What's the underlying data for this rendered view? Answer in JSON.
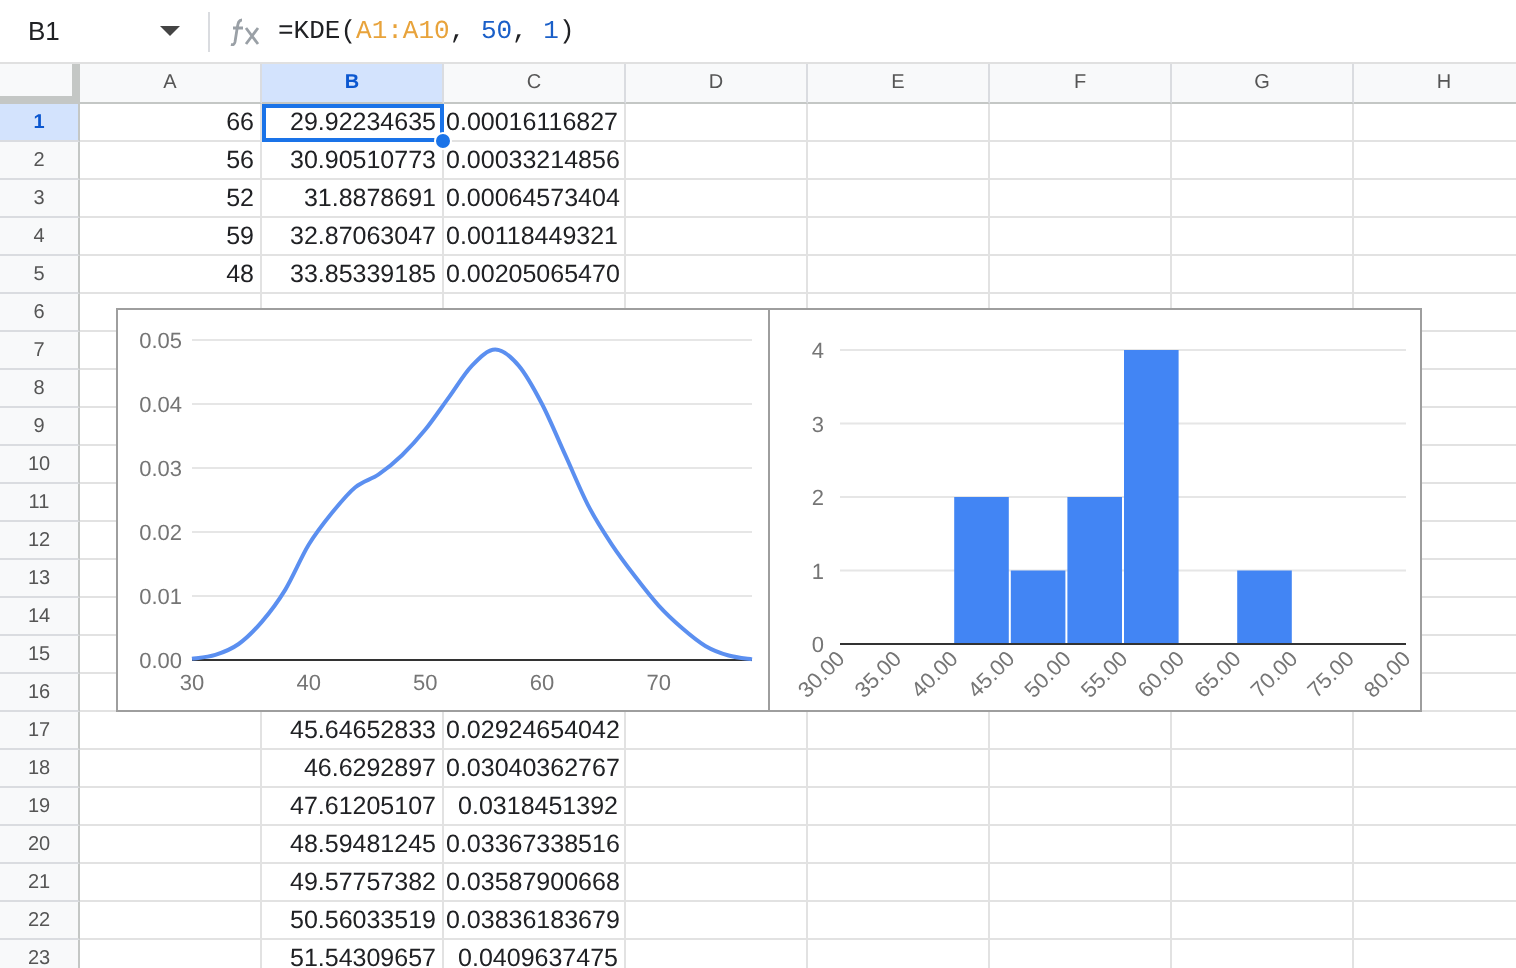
{
  "name_box": {
    "value": "B1"
  },
  "formula": [
    {
      "kind": "text",
      "text": "=KDE("
    },
    {
      "kind": "range",
      "text": "A1:A10"
    },
    {
      "kind": "text",
      "text": ", "
    },
    {
      "kind": "number",
      "text": "50"
    },
    {
      "kind": "text",
      "text": ", "
    },
    {
      "kind": "number",
      "text": "1"
    },
    {
      "kind": "text",
      "text": ")"
    }
  ],
  "columns": [
    {
      "label": "A",
      "selected": false
    },
    {
      "label": "B",
      "selected": true
    },
    {
      "label": "C",
      "selected": false
    },
    {
      "label": "D",
      "selected": false
    },
    {
      "label": "E",
      "selected": false
    },
    {
      "label": "F",
      "selected": false
    },
    {
      "label": "G",
      "selected": false
    },
    {
      "label": "H",
      "selected": false
    }
  ],
  "rows": [
    {
      "label": "1",
      "selected": true,
      "cells": {
        "col_a": "66",
        "col_b": "29.92234635",
        "col_c": "0.00016116827"
      }
    },
    {
      "label": "2",
      "selected": false,
      "cells": {
        "col_a": "56",
        "col_b": "30.90510773",
        "col_c": "0.00033214856"
      }
    },
    {
      "label": "3",
      "selected": false,
      "cells": {
        "col_a": "52",
        "col_b": "31.8878691",
        "col_c": "0.00064573404"
      }
    },
    {
      "label": "4",
      "selected": false,
      "cells": {
        "col_a": "59",
        "col_b": "32.87063047",
        "col_c": "0.00118449321"
      }
    },
    {
      "label": "5",
      "selected": false,
      "cells": {
        "col_a": "48",
        "col_b": "33.85339185",
        "col_c": "0.00205065470"
      }
    },
    {
      "label": "6",
      "selected": false
    },
    {
      "label": "7",
      "selected": false
    },
    {
      "label": "8",
      "selected": false
    },
    {
      "label": "9",
      "selected": false
    },
    {
      "label": "10",
      "selected": false
    },
    {
      "label": "11",
      "selected": false
    },
    {
      "label": "12",
      "selected": false
    },
    {
      "label": "13",
      "selected": false
    },
    {
      "label": "14",
      "selected": false
    },
    {
      "label": "15",
      "selected": false
    },
    {
      "label": "16",
      "selected": false
    },
    {
      "label": "17",
      "selected": false,
      "cells": {
        "col_b": "45.64652833",
        "col_c": "0.02924654042"
      }
    },
    {
      "label": "18",
      "selected": false,
      "cells": {
        "col_b": "46.6292897",
        "col_c": "0.03040362767"
      }
    },
    {
      "label": "19",
      "selected": false,
      "cells": {
        "col_b": "47.61205107",
        "col_c": "0.0318451392"
      }
    },
    {
      "label": "20",
      "selected": false,
      "cells": {
        "col_b": "48.59481245",
        "col_c": "0.03367338516"
      }
    },
    {
      "label": "21",
      "selected": false,
      "cells": {
        "col_b": "49.57757382",
        "col_c": "0.03587900668"
      }
    },
    {
      "label": "22",
      "selected": false,
      "cells": {
        "col_b": "50.56033519",
        "col_c": "0.03836183679"
      }
    },
    {
      "label": "23",
      "selected": false,
      "cells": {
        "col_b": "51.54309657",
        "col_c": "0.0409637475"
      }
    }
  ],
  "charts": [
    {
      "chart_data": {
        "type": "line",
        "grid": true,
        "x": [
          30,
          32,
          34,
          36,
          38,
          40,
          42,
          44,
          46,
          48,
          50,
          52,
          54,
          56,
          58,
          60,
          62,
          64,
          66,
          68,
          70,
          72,
          74,
          76,
          78
        ],
        "xlim": [
          30,
          78
        ],
        "ylim": [
          0,
          0.05
        ],
        "xticks": [
          30,
          40,
          50,
          60,
          70
        ],
        "yticks": [
          {
            "value": 0,
            "label": "0.00"
          },
          {
            "value": 0.01,
            "label": "0.01"
          },
          {
            "value": 0.02,
            "label": "0.02"
          },
          {
            "value": 0.03,
            "label": "0.03"
          },
          {
            "value": 0.04,
            "label": "0.04"
          },
          {
            "value": 0.05,
            "label": "0.05"
          }
        ],
        "series": [
          {
            "color": "#5b8ff0",
            "values": [
              0.0002,
              0.0008,
              0.0025,
              0.006,
              0.011,
              0.018,
              0.023,
              0.027,
              0.029,
              0.032,
              0.036,
              0.041,
              0.046,
              0.0485,
              0.046,
              0.04,
              0.032,
              0.024,
              0.018,
              0.013,
              0.0085,
              0.005,
              0.0022,
              0.0007,
              0.0001
            ]
          }
        ]
      }
    },
    {
      "chart_data": {
        "type": "bar",
        "grid": true,
        "x": [
          32.5,
          37.5,
          42.5,
          47.5,
          52.5,
          57.5,
          62.5,
          67.5,
          72.5,
          77.5
        ],
        "xlim": [
          30,
          80
        ],
        "ylim": [
          0,
          4
        ],
        "xticks": [
          {
            "value": 30,
            "label": "30.00"
          },
          {
            "value": 35,
            "label": "35.00"
          },
          {
            "value": 40,
            "label": "40.00"
          },
          {
            "value": 45,
            "label": "45.00"
          },
          {
            "value": 50,
            "label": "50.00"
          },
          {
            "value": 55,
            "label": "55.00"
          },
          {
            "value": 60,
            "label": "60.00"
          },
          {
            "value": 65,
            "label": "65.00"
          },
          {
            "value": 70,
            "label": "70.00"
          },
          {
            "value": 75,
            "label": "75.00"
          },
          {
            "value": 80,
            "label": "80.00"
          }
        ],
        "yticks": [
          0,
          1,
          2,
          3,
          4
        ],
        "series": [
          {
            "color": "#4285f4",
            "values": [
              0,
              0,
              2,
              1,
              2,
              4,
              0,
              1,
              0,
              0
            ]
          }
        ]
      }
    }
  ]
}
